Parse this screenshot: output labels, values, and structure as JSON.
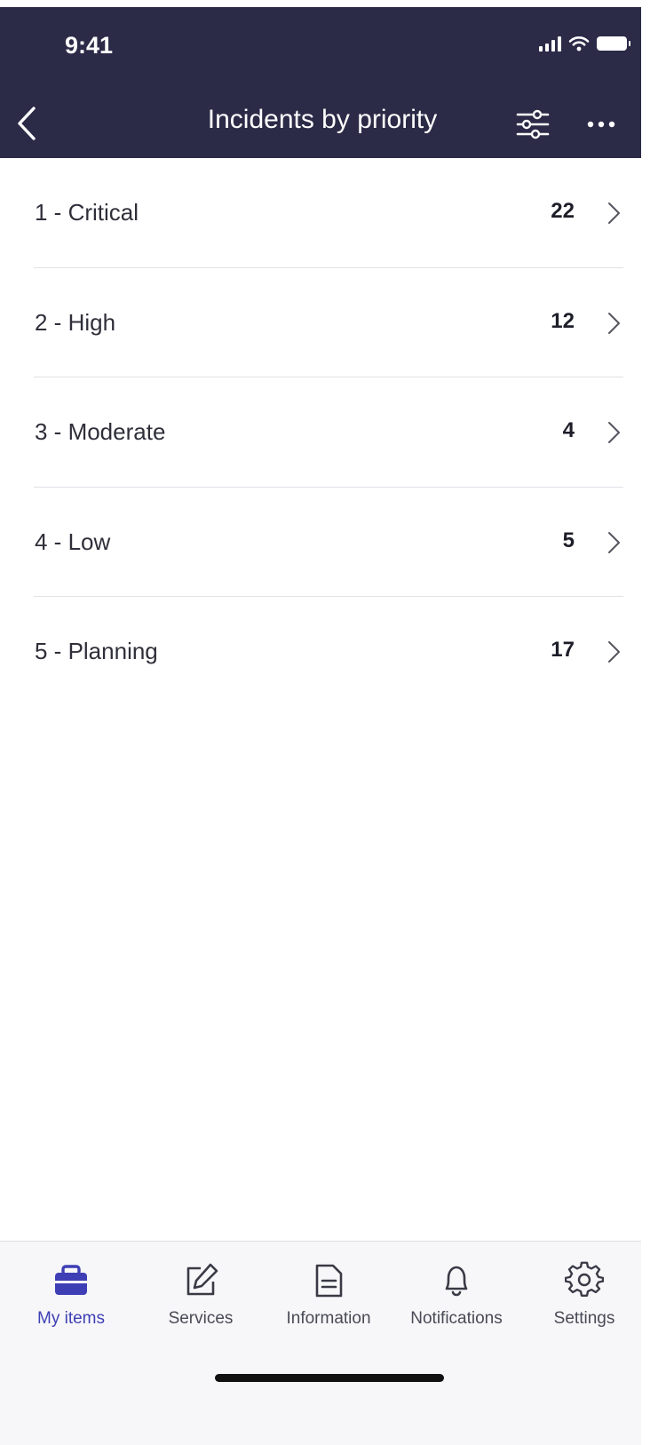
{
  "status_bar": {
    "time": "9:41"
  },
  "nav_bar": {
    "title": "Incidents by priority",
    "back_icon": "chevron-left-icon",
    "filter_icon": "sliders-icon",
    "more_icon": "ellipsis-icon"
  },
  "colors": {
    "header_bg": "#2b2b48",
    "accent": "#3e3fb5",
    "tab_bar_bg": "#f7f7f9"
  },
  "priorities": [
    {
      "label": "1 - Critical",
      "count": "22"
    },
    {
      "label": "2 - High",
      "count": "12"
    },
    {
      "label": "3 - Moderate",
      "count": "4"
    },
    {
      "label": "4 - Low",
      "count": "5"
    },
    {
      "label": "5 - Planning",
      "count": "17"
    }
  ],
  "tab_bar": {
    "active": "My items",
    "items": [
      {
        "label": "My items",
        "icon": "briefcase-icon"
      },
      {
        "label": "Services",
        "icon": "edit-icon"
      },
      {
        "label": "Information",
        "icon": "document-icon"
      },
      {
        "label": "Notifications",
        "icon": "bell-icon"
      },
      {
        "label": "Settings",
        "icon": "gear-icon"
      }
    ]
  }
}
